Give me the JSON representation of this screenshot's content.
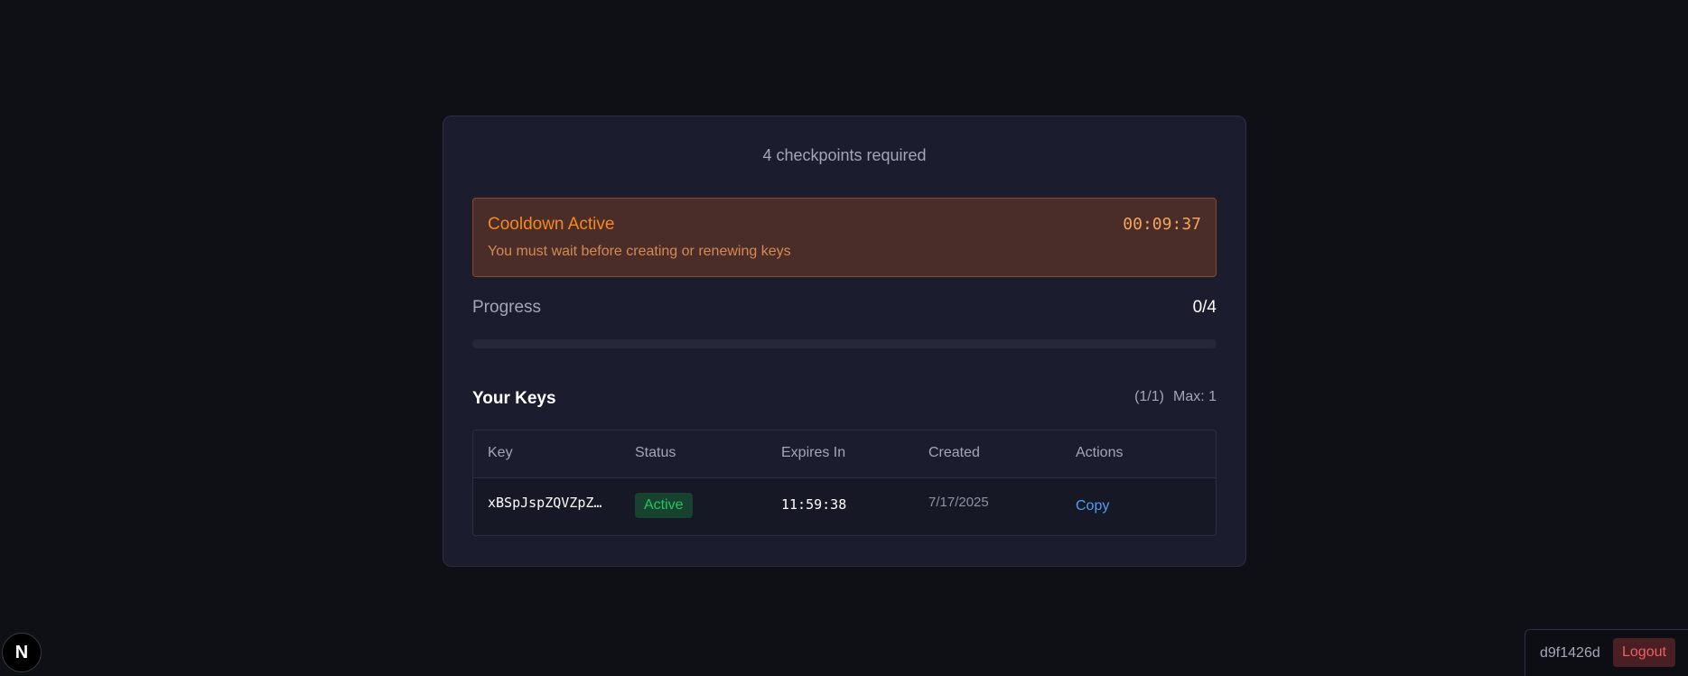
{
  "card": {
    "checkpoints_text": "4 checkpoints required"
  },
  "cooldown": {
    "title": "Cooldown Active",
    "message": "You must wait before creating or renewing keys",
    "timer": "00:09:37"
  },
  "progress": {
    "label": "Progress",
    "value_text": "0/4",
    "fraction": 0
  },
  "keys": {
    "title": "Your Keys",
    "count_text": "(1/1)",
    "max_text": "Max: 1",
    "columns": [
      "Key",
      "Status",
      "Expires In",
      "Created",
      "Actions"
    ],
    "rows": [
      {
        "key": "xBSpJspZQVZpZ…",
        "status": "Active",
        "expires_in": "11:59:38",
        "created": "7/17/2025",
        "action": "Copy"
      }
    ]
  },
  "footer": {
    "badge_letter": "N",
    "user_id": "d9f1426d",
    "logout_label": "Logout"
  },
  "colors": {
    "background": "#0f1016",
    "card": "#1b1c2e",
    "cooldown_accent": "#f5891f",
    "active_green": "#22c55e",
    "link_blue": "#4f9cf0",
    "logout_red": "#f05e66"
  }
}
